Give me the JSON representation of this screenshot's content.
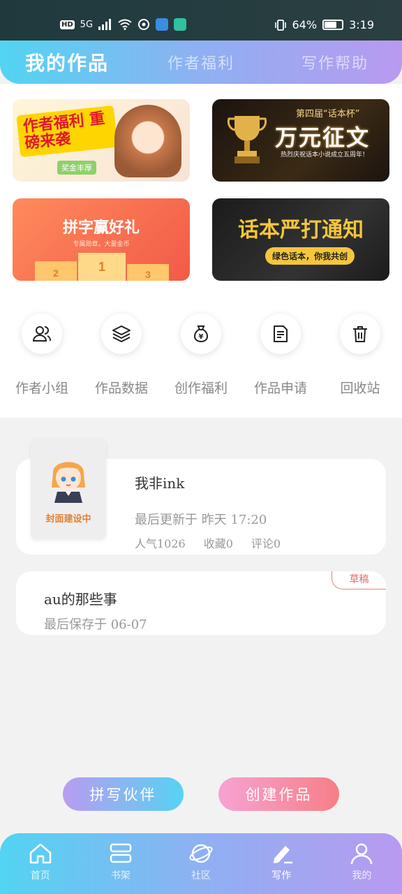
{
  "status_bar": {
    "hd": "HD",
    "network": "5G",
    "battery_text": "64%",
    "battery_level": 0.64,
    "time": "3:19"
  },
  "header": {
    "tabs": [
      {
        "label": "我的作品",
        "active": true
      },
      {
        "label": "作者福利",
        "active": false
      },
      {
        "label": "写作帮助",
        "active": false
      }
    ]
  },
  "banners": [
    {
      "main": "作者福利 重磅来袭",
      "sub": "奖金丰厚"
    },
    {
      "small": "第四届“话本杯”",
      "main": "万元征文",
      "sub": "热烈庆祝话本小说成立五周年！"
    },
    {
      "main": "拼字赢好礼",
      "sub": "专属勋章，大量金币"
    },
    {
      "main": "话本严打通知",
      "sub": "绿色话本，你我共创"
    }
  ],
  "quick_actions": [
    {
      "label": "作者小组",
      "icon": "users-icon"
    },
    {
      "label": "作品数据",
      "icon": "layers-icon"
    },
    {
      "label": "创作福利",
      "icon": "money-bag-icon"
    },
    {
      "label": "作品申请",
      "icon": "document-icon"
    },
    {
      "label": "回收站",
      "icon": "trash-icon"
    }
  ],
  "work": {
    "cover_text": "封面建设中",
    "title": "我非ink",
    "updated": "最后更新于 昨天 17:20",
    "popularity": "人气1026",
    "favorites": "收藏0",
    "comments": "评论0"
  },
  "draft": {
    "badge": "草稿",
    "title": "au的那些事",
    "saved": "最后保存于 06-07"
  },
  "buttons": {
    "partner": "拼写伙伴",
    "create": "创建作品"
  },
  "bottom_nav": [
    {
      "label": "首页",
      "icon": "home-icon"
    },
    {
      "label": "书架",
      "icon": "bookshelf-icon"
    },
    {
      "label": "社区",
      "icon": "planet-icon"
    },
    {
      "label": "写作",
      "icon": "pen-icon",
      "active": true
    },
    {
      "label": "我的",
      "icon": "user-icon"
    }
  ],
  "colors": {
    "header_gradient": [
      "#52d4f2",
      "#8fb0f2",
      "#b89af0"
    ],
    "draft_badge": "#e56b69"
  }
}
